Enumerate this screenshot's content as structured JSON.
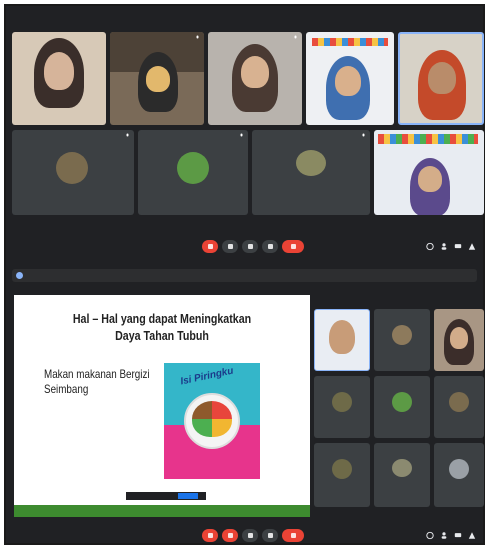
{
  "top_meet": {
    "tiles_row1": [
      "",
      "",
      "",
      "",
      ""
    ],
    "tiles_row2": [
      "",
      "",
      "",
      ""
    ],
    "time": ""
  },
  "bottom_meet": {
    "notice_text": "",
    "participants": [
      "",
      "",
      "",
      "",
      "",
      "",
      "",
      "",
      ""
    ],
    "time": ""
  },
  "slide": {
    "title_line1": "Hal – Hal yang dapat Meningkatkan",
    "title_line2": "Daya Tahan Tubuh",
    "bullet_line1": "Makan makanan Bergizi",
    "bullet_line2": "Seimbang",
    "poster_title": "Isi Piringku"
  },
  "colors": {
    "background": "#202124",
    "tile": "#3c4043",
    "end_call": "#ea4335",
    "poster_teal": "#34b6c9",
    "poster_pink": "#e7348c"
  },
  "icons": [
    "mic-icon",
    "camera-icon",
    "captions-icon",
    "more-icon",
    "end-call-icon",
    "info-icon",
    "people-icon",
    "chat-icon",
    "activities-icon"
  ]
}
